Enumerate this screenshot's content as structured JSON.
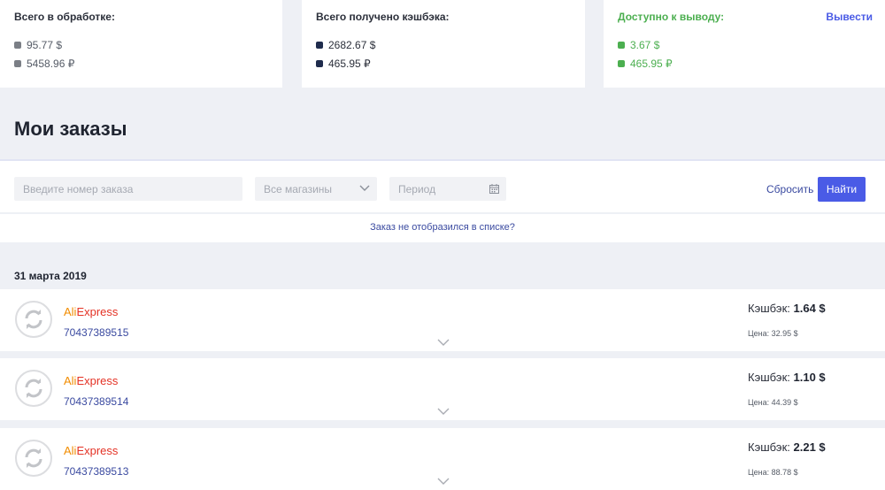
{
  "summary": {
    "processing": {
      "title": "Всего в обработке:",
      "usd": "95.77 $",
      "rub": "5458.96 ₽"
    },
    "received": {
      "title": "Всего получено кэшбэка:",
      "usd": "2682.67 $",
      "rub": "465.95 ₽"
    },
    "available": {
      "title": "Доступно к выводу:",
      "withdraw_label": "Вывести",
      "usd": "3.67 $",
      "rub": "465.95 ₽"
    }
  },
  "page_title": "Мои заказы",
  "filters": {
    "order_placeholder": "Введите номер заказа",
    "shops_value": "Все магазины",
    "period_placeholder": "Период",
    "reset_label": "Сбросить",
    "find_label": "Найти"
  },
  "missing_order_link": "Заказ не отобразился в списке?",
  "date_heading": "31 марта 2019",
  "orders": [
    {
      "store_ali": "Ali",
      "store_express": "Express",
      "number": "70437389515",
      "cashback_label": "Кэшбэк:",
      "cashback": "1.64 $",
      "price": "Цена: 32.95 $"
    },
    {
      "store_ali": "Ali",
      "store_express": "Express",
      "number": "70437389514",
      "cashback_label": "Кэшбэк:",
      "cashback": "1.10 $",
      "price": "Цена: 44.39 $"
    },
    {
      "store_ali": "Ali",
      "store_express": "Express",
      "number": "70437389513",
      "cashback_label": "Кэшбэк:",
      "cashback": "2.21 $",
      "price": "Цена: 88.78 $"
    }
  ],
  "colors": {
    "accent": "#4a5be6",
    "available_green": "#4caf50",
    "link_blue": "#3a4aa0",
    "aliexpress_red": "#e43225",
    "aliexpress_orange": "#f28c00"
  }
}
